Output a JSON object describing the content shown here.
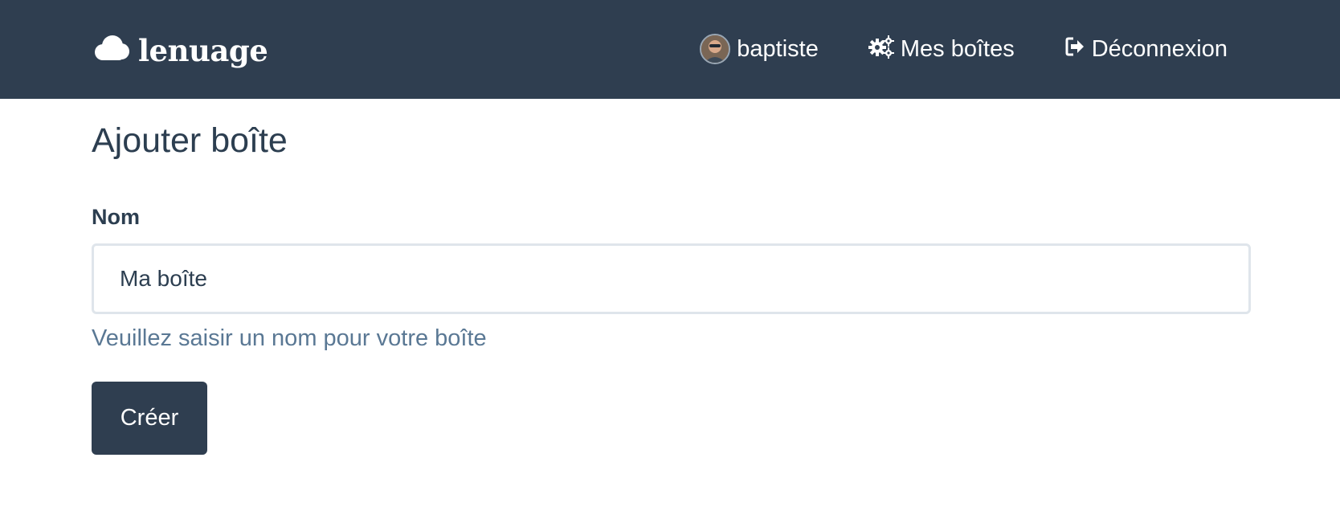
{
  "navbar": {
    "brand": "lenuage",
    "user_label": "baptiste",
    "boxes_label": "Mes boîtes",
    "logout_label": "Déconnexion"
  },
  "icons": {
    "brand": "cloud-icon",
    "user": "avatar",
    "boxes": "cogs-icon",
    "logout": "sign-out-icon"
  },
  "form": {
    "title": "Ajouter boîte",
    "name_label": "Nom",
    "name_value": "Ma boîte",
    "help_text": "Veuillez saisir un nom pour votre boîte",
    "submit_label": "Créer"
  },
  "colors": {
    "navbar_bg": "#2f3e50",
    "text": "#2c3e50",
    "help_text": "#5a7894",
    "input_border": "#dfe5eb"
  }
}
